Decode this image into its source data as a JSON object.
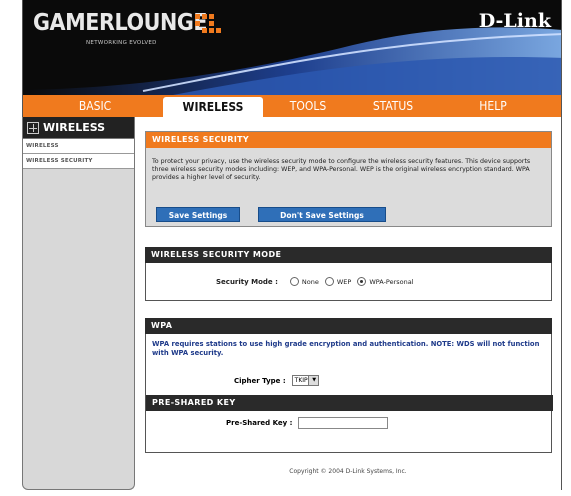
{
  "header": {
    "brand": "GAMERLOUNGE",
    "tagline": "NETWORKING EVOLVED",
    "vendor": "D-Link",
    "colors": {
      "accent": "#f07a1e",
      "background": "#0a0a0a",
      "swoosh": "#1e3f8e"
    }
  },
  "nav": {
    "tabs": [
      {
        "label": "BASIC"
      },
      {
        "label": "WIRELESS"
      },
      {
        "label": "TOOLS"
      },
      {
        "label": "STATUS"
      },
      {
        "label": "HELP"
      }
    ],
    "active": "WIRELESS"
  },
  "sidebar": {
    "title": "WIRELESS",
    "items": [
      {
        "label": "WIRELESS"
      },
      {
        "label": "WIRELESS SECURITY"
      }
    ]
  },
  "security": {
    "title": "WIRELESS SECURITY",
    "description": "To protect your privacy, use the wireless security mode to configure the wireless security features. This device supports three wireless security modes including: WEP, and WPA-Personal. WEP is the original wireless encryption standard. WPA provides a higher level of security.",
    "save_label": "Save Settings",
    "dont_save_label": "Don't Save Settings"
  },
  "mode": {
    "title": "WIRELESS SECURITY MODE",
    "label": "Security Mode :",
    "options": [
      "None",
      "WEP",
      "WPA-Personal"
    ],
    "selected": "WPA-Personal"
  },
  "wpa": {
    "title": "WPA",
    "note": "WPA requires stations to use high grade encryption and authentication. NOTE: WDS will not function with WPA security.",
    "cipher_label": "Cipher Type :",
    "cipher_value": "TKIP"
  },
  "psk": {
    "title": "PRE-SHARED KEY",
    "label": "Pre-Shared Key :",
    "value": ""
  },
  "footer": {
    "copyright": "Copyright © 2004 D-Link Systems, Inc."
  }
}
